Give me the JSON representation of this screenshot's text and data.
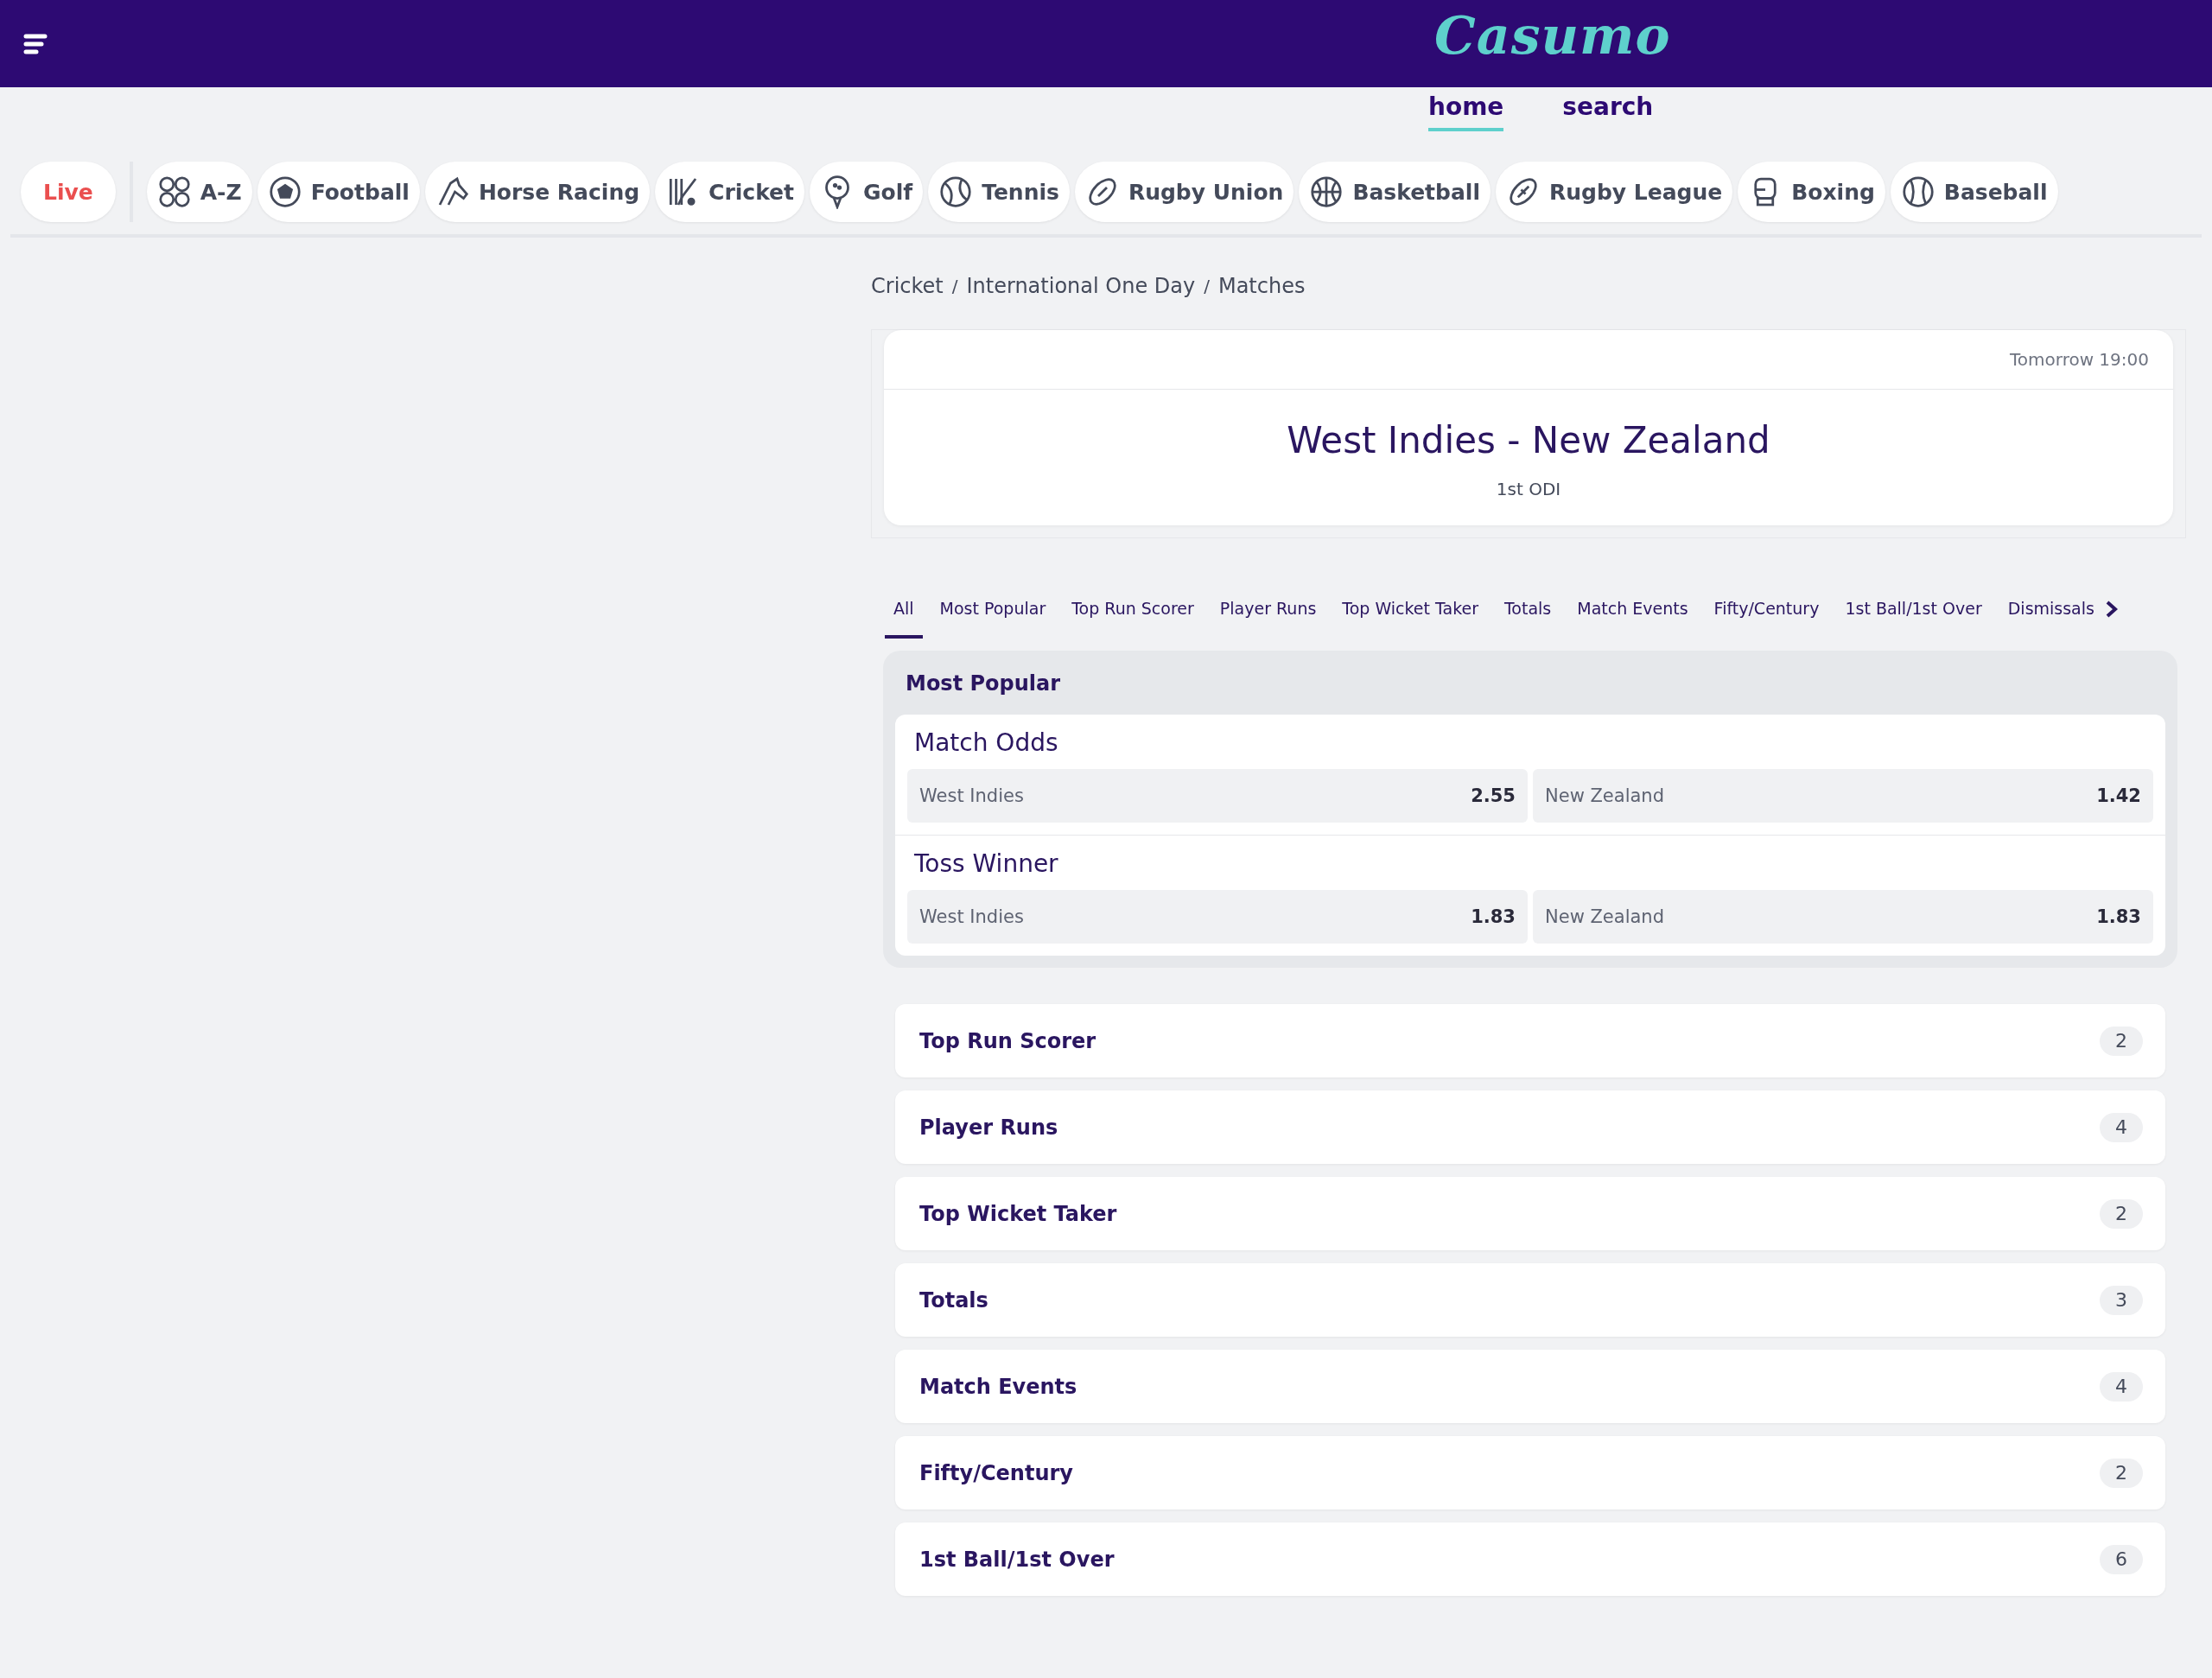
{
  "header": {
    "logo": "Casumo"
  },
  "nav": [
    {
      "label": "home",
      "selected": true
    },
    {
      "label": "search",
      "selected": false
    }
  ],
  "sports": [
    {
      "label": "Live",
      "kind": "live"
    },
    {
      "label": "A-Z",
      "kind": "sport"
    },
    {
      "label": "Football",
      "kind": "sport"
    },
    {
      "label": "Horse Racing",
      "kind": "sport"
    },
    {
      "label": "Cricket",
      "kind": "sport"
    },
    {
      "label": "Golf",
      "kind": "sport"
    },
    {
      "label": "Tennis",
      "kind": "sport"
    },
    {
      "label": "Rugby Union",
      "kind": "sport"
    },
    {
      "label": "Basketball",
      "kind": "sport"
    },
    {
      "label": "Rugby League",
      "kind": "sport"
    },
    {
      "label": "Boxing",
      "kind": "sport"
    },
    {
      "label": "Baseball",
      "kind": "sport"
    }
  ],
  "breadcrumb": {
    "separator": "/",
    "items": [
      "Cricket",
      "International One Day",
      "Matches"
    ]
  },
  "match": {
    "time": "Tomorrow 19:00",
    "title": "West Indies - New Zealand",
    "subtitle": "1st ODI"
  },
  "market_tabs": [
    {
      "label": "All",
      "selected": true
    },
    {
      "label": "Most Popular",
      "selected": false
    },
    {
      "label": "Top Run Scorer",
      "selected": false
    },
    {
      "label": "Player Runs",
      "selected": false
    },
    {
      "label": "Top Wicket Taker",
      "selected": false
    },
    {
      "label": "Totals",
      "selected": false
    },
    {
      "label": "Match Events",
      "selected": false
    },
    {
      "label": "Fifty/Century",
      "selected": false
    },
    {
      "label": "1st Ball/1st Over",
      "selected": false
    },
    {
      "label": "Dismissals",
      "selected": false
    }
  ],
  "most_popular": {
    "title": "Most Popular",
    "markets": [
      {
        "name": "Match Odds",
        "outcomes": [
          {
            "label": "West Indies",
            "odds": "2.55"
          },
          {
            "label": "New Zealand",
            "odds": "1.42"
          }
        ]
      },
      {
        "name": "Toss Winner",
        "outcomes": [
          {
            "label": "West Indies",
            "odds": "1.83"
          },
          {
            "label": "New Zealand",
            "odds": "1.83"
          }
        ]
      }
    ]
  },
  "market_groups": [
    {
      "name": "Top Run Scorer",
      "count": "2"
    },
    {
      "name": "Player Runs",
      "count": "4"
    },
    {
      "name": "Top Wicket Taker",
      "count": "2"
    },
    {
      "name": "Totals",
      "count": "3"
    },
    {
      "name": "Match Events",
      "count": "4"
    },
    {
      "name": "Fifty/Century",
      "count": "2"
    },
    {
      "name": "1st Ball/1st Over",
      "count": "6"
    }
  ]
}
